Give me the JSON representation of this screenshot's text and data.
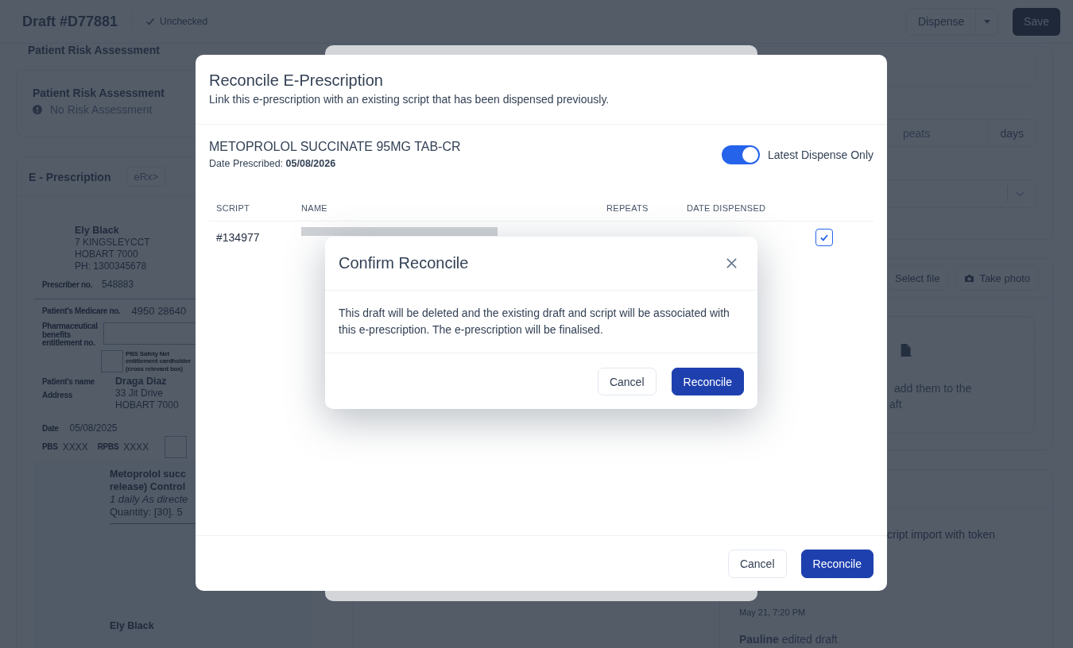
{
  "header": {
    "title": "Draft #D77881",
    "status": "Unchecked",
    "dispense_button": "Dispense",
    "save_button": "Save"
  },
  "risk": {
    "section_title": "Patient Risk Assessment",
    "card_title": "Patient Risk Assessment",
    "status": "No Risk Assessment"
  },
  "eprescription": {
    "title": "E - Prescription",
    "badge": "eRx>",
    "prescriber": {
      "name": "Ely Black",
      "lines": [
        "7 KINGSLEYCCT",
        "HOBART 7000",
        "PH: 1300345678"
      ],
      "number_label": "Prescriber no.",
      "number": "548883"
    },
    "medicare_label": "Patient's Medicare no.",
    "medicare": "4950 28640",
    "entitlement_label": "Pharmaceutical benefits entitlement no.",
    "safety_net_label": "PBS Safety Net entitlement cardholder (cross relevant box)",
    "patient_label": "Patient's name",
    "address_label": "Address",
    "patient_name": "Draga Diaz",
    "patient_address": [
      "33 Jit Drive",
      "HOBART 7000"
    ],
    "safety_net_checked": false,
    "date_label": "Date",
    "date": "05/08/2025",
    "pbs_label": "PBS",
    "pbs": "XXXX",
    "rpbs_label": "RPBS",
    "rpbs": "XXXX",
    "brand_box_checked": false,
    "medication": {
      "name_lines": [
        "Metoprolol succ",
        "release) Control"
      ],
      "directions": "1 daily As directe",
      "quantity": "Quantity: [30]. 5"
    },
    "signature": {
      "name": "Ely Black"
    }
  },
  "dispense_form": {
    "repeats_text": "peats",
    "days_addon": "days"
  },
  "attachments": {
    "select_file": "Select file",
    "take_photo": "Take photo",
    "drop_lines": [
      "add them to the",
      "aft"
    ]
  },
  "activity": {
    "note": "cript import with token",
    "items": [
      {
        "time": "May 21, 7:20 PM"
      },
      {
        "text": "**Pauline** edited draft"
      }
    ]
  },
  "reconcile_dialog": {
    "title": "Reconcile E-Prescription",
    "subtitle": "Link this e-prescription with an existing script that has been dispensed previously.",
    "drug": "METOPROLOL SUCCINATE 95MG TAB-CR",
    "date_prescribed": "Date Prescribed: **05/08/2026**",
    "toggle": {
      "label": "Latest Dispense Only",
      "on": true
    },
    "columns": [
      "SCRIPT",
      "NAME",
      "REPEATS",
      "DATE DISPENSED"
    ],
    "rows": [
      {
        "script": "#134977",
        "selected": true
      }
    ],
    "cancel": "Cancel",
    "confirm": "Reconcile"
  },
  "confirm_dialog": {
    "title": "Confirm Reconcile",
    "message": "This draft will be deleted and the existing draft and script will be associated with this e-prescription. The e-prescription will be finalised.",
    "cancel": "Cancel",
    "confirm": "Reconcile"
  }
}
